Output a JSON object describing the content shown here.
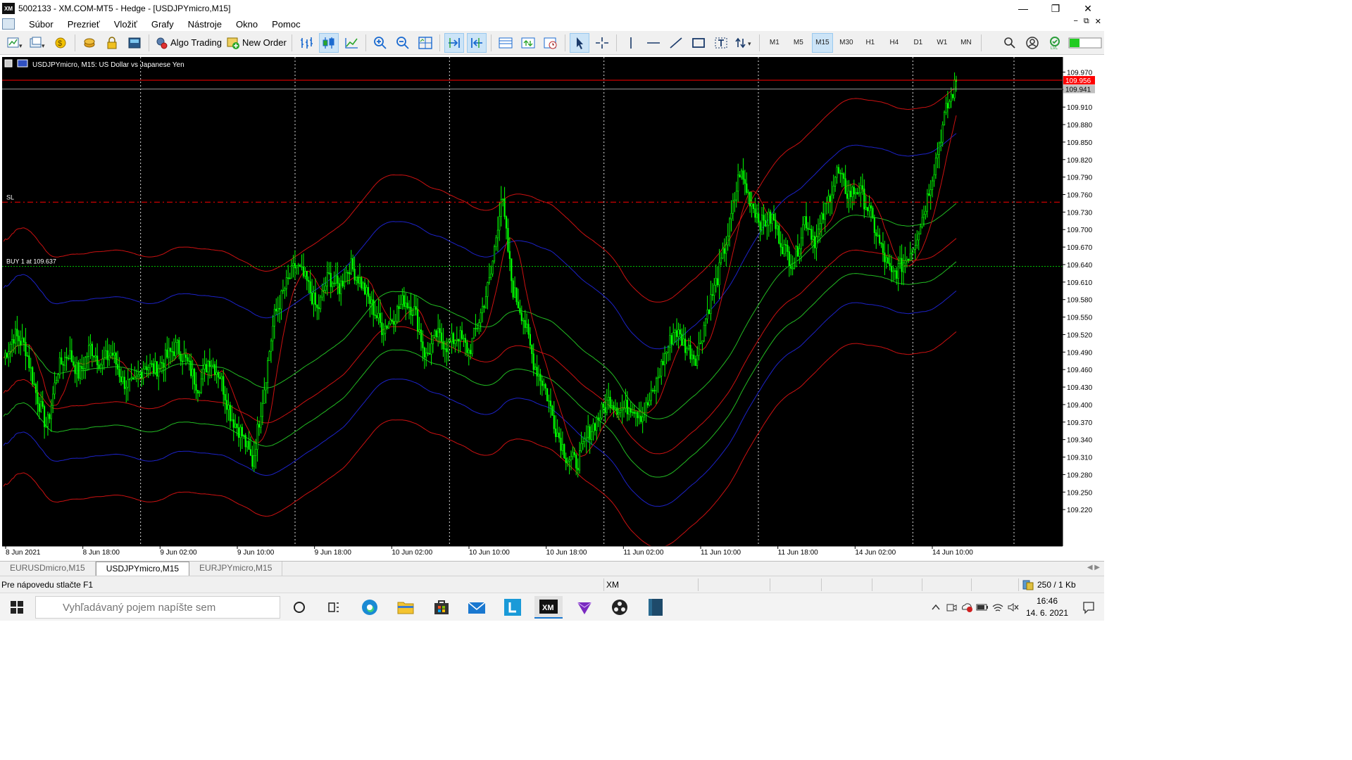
{
  "window": {
    "title": "5002133 - XM.COM-MT5 - Hedge - [USDJPYmicro,M15]",
    "app_badge": "XM",
    "minimize": "—",
    "restore": "❐",
    "close": "✕"
  },
  "menu": {
    "items": [
      "Súbor",
      "Prezrieť",
      "Vložiť",
      "Grafy",
      "Nástroje",
      "Okno",
      "Pomoc"
    ],
    "mdi": [
      "−",
      "⧉",
      "✕"
    ]
  },
  "toolbar": {
    "algo_trading": "Algo Trading",
    "new_order": "New Order",
    "timeframes": [
      "M1",
      "M5",
      "M15",
      "M30",
      "H1",
      "H4",
      "D1",
      "W1",
      "MN"
    ],
    "active_timeframe": "M15"
  },
  "chart": {
    "header": "USDJPYmicro, M15:  US Dollar vs Japanese Yen",
    "sl_label": "SL",
    "buy_label": "BUY 1 at 109.637",
    "bid_tag": "109.956",
    "ask_tag": "109.941",
    "colors": {
      "background": "#000000",
      "candles": "#00ff00",
      "bid_line": "#ff0000",
      "sl_line": "#ff0000",
      "buy_line": "#00c000",
      "band_red": "#cc1111",
      "band_blue": "#1c22c8",
      "band_green": "#22bb22",
      "axis": "#ffffff"
    }
  },
  "chart_data": {
    "type": "candlestick",
    "symbol": "USDJPYmicro",
    "timeframe": "M15",
    "ylim": [
      109.19,
      109.985
    ],
    "price_ticks": [
      "109.970",
      "109.940",
      "109.910",
      "109.880",
      "109.850",
      "109.820",
      "109.790",
      "109.760",
      "109.730",
      "109.700",
      "109.670",
      "109.640",
      "109.610",
      "109.580",
      "109.550",
      "109.520",
      "109.490",
      "109.460",
      "109.430",
      "109.400",
      "109.370",
      "109.340",
      "109.310",
      "109.280",
      "109.250",
      "109.220"
    ],
    "time_ticks": [
      "8 Jun 2021",
      "8 Jun 18:00",
      "9 Jun 02:00",
      "9 Jun 10:00",
      "9 Jun 18:00",
      "10 Jun 02:00",
      "10 Jun 10:00",
      "10 Jun 18:00",
      "11 Jun 02:00",
      "11 Jun 10:00",
      "11 Jun 18:00",
      "14 Jun 02:00",
      "14 Jun 10:00"
    ],
    "close_path": [
      109.48,
      109.52,
      109.5,
      109.42,
      109.36,
      109.46,
      109.49,
      109.45,
      109.5,
      109.47,
      109.49,
      109.44,
      109.43,
      109.47,
      109.46,
      109.48,
      109.5,
      109.47,
      109.43,
      109.48,
      109.45,
      109.38,
      109.35,
      109.3,
      109.42,
      109.55,
      109.6,
      109.64,
      109.61,
      109.56,
      109.62,
      109.6,
      109.64,
      109.61,
      109.57,
      109.53,
      109.55,
      109.58,
      109.56,
      109.48,
      109.52,
      109.5,
      109.52,
      109.49,
      109.55,
      109.62,
      109.76,
      109.6,
      109.55,
      109.47,
      109.43,
      109.36,
      109.31,
      109.3,
      109.35,
      109.38,
      109.41,
      109.39,
      109.4,
      109.38,
      109.42,
      109.48,
      109.53,
      109.5,
      109.48,
      109.56,
      109.62,
      109.7,
      109.8,
      109.75,
      109.71,
      109.72,
      109.67,
      109.64,
      109.72,
      109.68,
      109.74,
      109.8,
      109.76,
      109.77,
      109.73,
      109.67,
      109.62,
      109.64,
      109.67,
      109.73,
      109.81,
      109.9,
      109.953
    ],
    "current_bid": 109.956,
    "current_ask": 109.941,
    "sl_level": 109.747,
    "buy_level": 109.637
  },
  "tabs": [
    "EURUSDmicro,M15",
    "USDJPYmicro,M15",
    "EURJPYmicro,M15"
  ],
  "active_tab": "USDJPYmicro,M15",
  "tab_arrows": "◀ ▶",
  "status": {
    "help": "Pre nápovedu stlačte F1",
    "server": "XM",
    "traffic": "250 / 1 Kb"
  },
  "taskbar": {
    "search_placeholder": "Vyhľadávaný pojem napíšte sem",
    "time": "16:46",
    "date": "14. 6. 2021"
  }
}
